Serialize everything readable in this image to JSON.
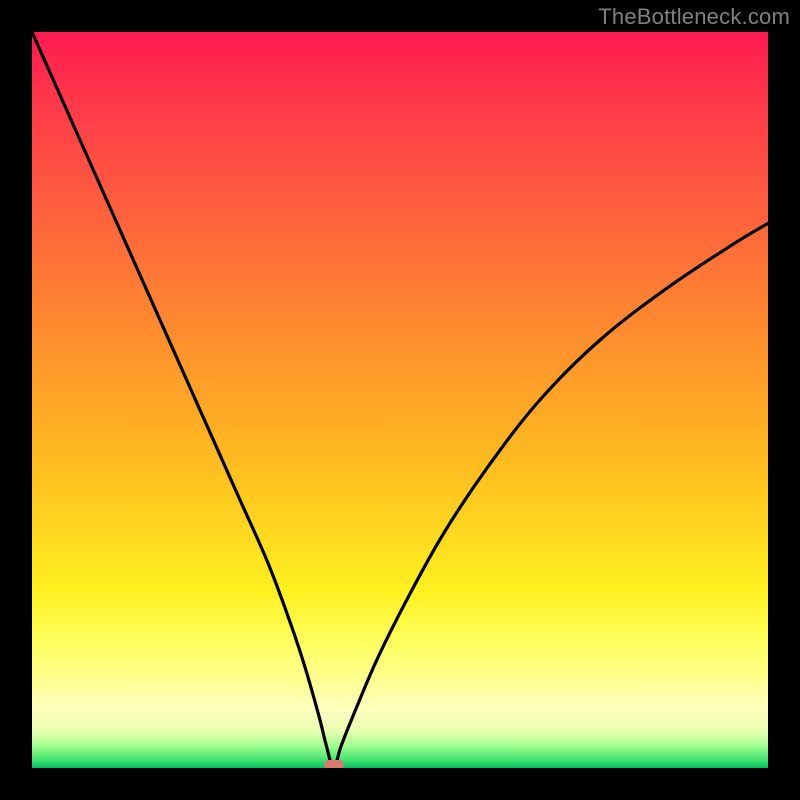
{
  "watermark": "TheBottleneck.com",
  "colors": {
    "black": "#000000",
    "marker": "#d97a6f",
    "gradient_top": "#ff1a50",
    "gradient_bottom": "#00c060"
  },
  "chart_data": {
    "type": "line",
    "title": "",
    "xlabel": "",
    "ylabel": "",
    "xlim": [
      0,
      100
    ],
    "ylim": [
      0,
      100
    ],
    "grid": false,
    "legend": false,
    "min_point": {
      "x": 41,
      "y": 0
    },
    "annotations": [
      "TheBottleneck.com"
    ],
    "series": [
      {
        "name": "bottleneck-curve",
        "x": [
          0,
          4,
          8,
          12,
          16,
          20,
          24,
          28,
          32,
          35,
          37,
          39,
          40,
          41,
          42,
          44,
          47,
          51,
          56,
          62,
          69,
          77,
          86,
          95,
          100
        ],
        "y": [
          100,
          91,
          82,
          73,
          64,
          55,
          46,
          37,
          28,
          20,
          14,
          7,
          3,
          0,
          3,
          8,
          15,
          23,
          32,
          41,
          50,
          58,
          65,
          71,
          74
        ]
      }
    ]
  }
}
